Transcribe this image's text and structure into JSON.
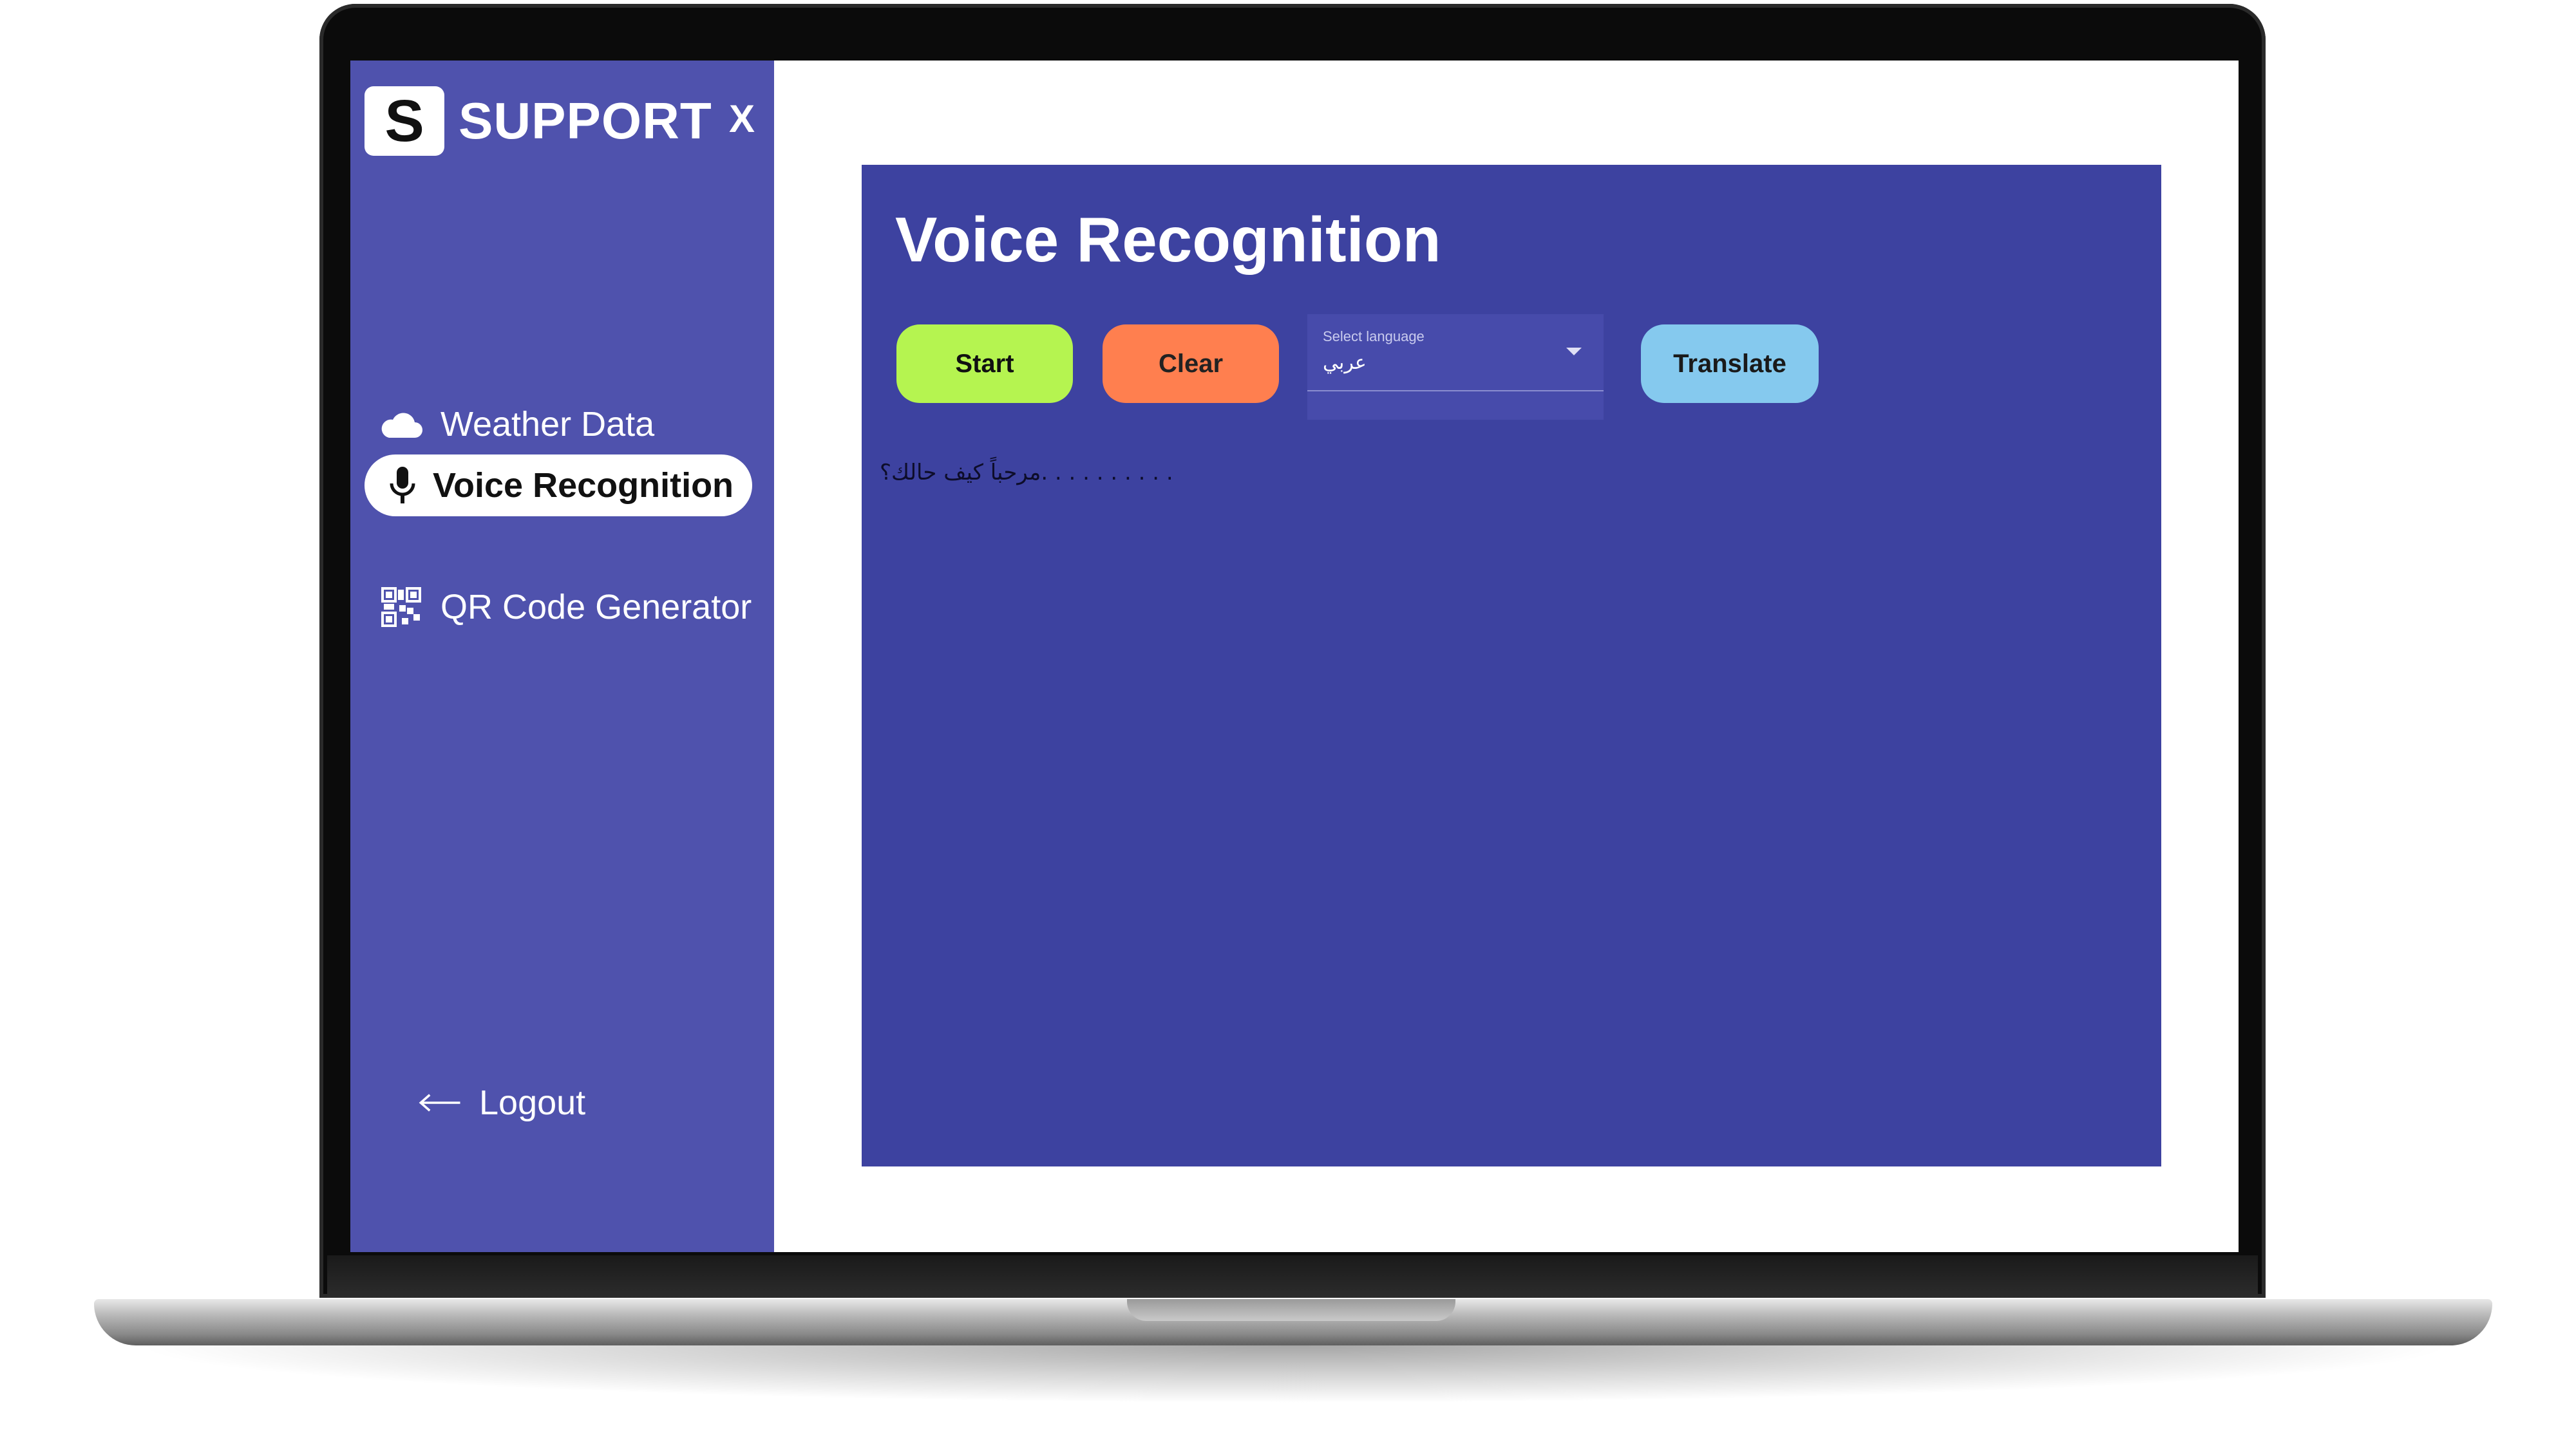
{
  "brand": {
    "logo_letter": "S",
    "name": "SUPPORT",
    "close_label": "X"
  },
  "sidebar": {
    "items": [
      {
        "label": "Weather Data",
        "icon": "cloud-icon",
        "active": false
      },
      {
        "label": "Voice Recognition",
        "icon": "microphone-icon",
        "active": true
      },
      {
        "label": "QR Code Generator",
        "icon": "qr-code-icon",
        "active": false
      }
    ],
    "logout": {
      "label": "Logout",
      "icon": "arrow-left-icon"
    }
  },
  "main": {
    "title": "Voice Recognition",
    "buttons": {
      "start": "Start",
      "clear": "Clear",
      "translate": "Translate"
    },
    "language_select": {
      "label": "Select language",
      "value": "عربي"
    },
    "transcript": "مرحباً كيف حالك؟. . . . . . . . . ."
  },
  "colors": {
    "sidebar_bg": "#4f52ad",
    "panel_bg": "#3d42a0",
    "start": "#b5f450",
    "clear": "#ff7f4f",
    "translate": "#85c9ee"
  }
}
